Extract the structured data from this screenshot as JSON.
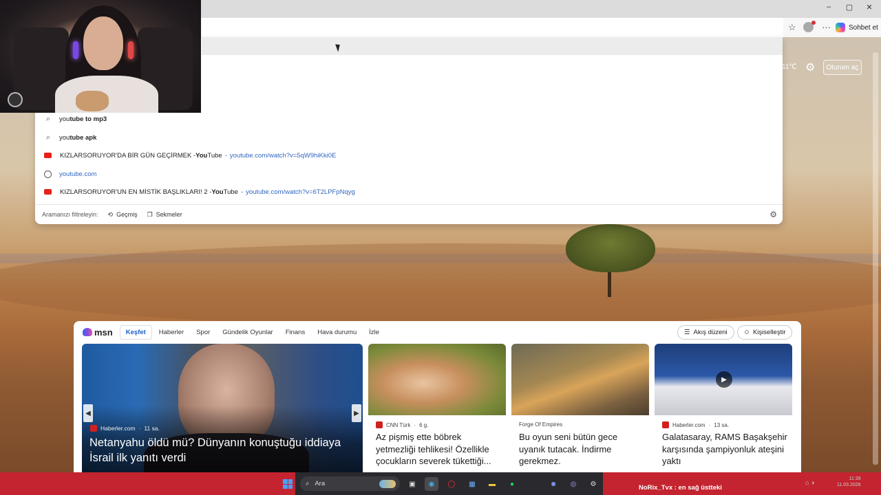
{
  "browser": {
    "chat_label": "Sohbet et",
    "window_controls": [
      "–",
      "▢",
      "✕"
    ]
  },
  "msn_header": {
    "weather_temp": "11℃",
    "signin_label": "Oturum aç"
  },
  "suggestions": {
    "items": [
      {
        "type": "search",
        "prefix": "you",
        "bold": "tube to mp3",
        "title": "",
        "url": ""
      },
      {
        "type": "search",
        "prefix": "you",
        "bold": "tube apk",
        "title": "",
        "url": ""
      },
      {
        "type": "history",
        "prefix": "KIZLARSORUYOR'DA BİR GÜN GEÇİRMEK - ",
        "bold": "You",
        "title": "Tube",
        "url": "youtube.com/watch?v=5qW9hiKki0E"
      },
      {
        "type": "site",
        "prefix": "",
        "bold": "",
        "title": "",
        "url": "youtube.com"
      },
      {
        "type": "history",
        "prefix": "KIZLARSORUYOR'UN EN MİSTİK BAŞLIKLARI! 2 - ",
        "bold": "You",
        "title": "Tube",
        "url": "youtube.com/watch?v=6T2LPFpNqyg"
      }
    ],
    "filter_label": "Aramanızı filtreleyin:",
    "filter_history": "Geçmiş",
    "filter_tabs": "Sekmeler"
  },
  "msn": {
    "logo": "msn",
    "tabs": [
      "Keşfet",
      "Haberler",
      "Spor",
      "Gündelik Oyunlar",
      "Finans",
      "Hava durumu",
      "İzle"
    ],
    "feed_layout_label": "Akış düzeni",
    "personalize_label": "Kişiselleştir",
    "hero": {
      "source": "Haberler.com",
      "age": "11 sa.",
      "title": "Netanyahu öldü mü? Dünyanın konuştuğu iddiaya İsrail ilk yanıtı verdi"
    },
    "cards": [
      {
        "source": "CNN Türk",
        "age": "6 g.",
        "title": "Az pişmiş ette böbrek yetmezliği tehlikesi! Özellikle çocukların severek tükettiği..."
      },
      {
        "source": "Forge Of Empires",
        "age": "",
        "title": "Bu oyun seni bütün gece uyanık tutacak. İndirme gerekmez."
      },
      {
        "source": "Haberler.com",
        "age": "13 sa.",
        "title": "Galatasaray, RAMS Başakşehir karşısında şampiyonluk ateşini yaktı"
      }
    ]
  },
  "taskbar": {
    "search_placeholder": "Ara",
    "stream_text": "NoRix_Tvx : en sağ üstteki",
    "time": "11:39",
    "date": "11.03.2026"
  }
}
